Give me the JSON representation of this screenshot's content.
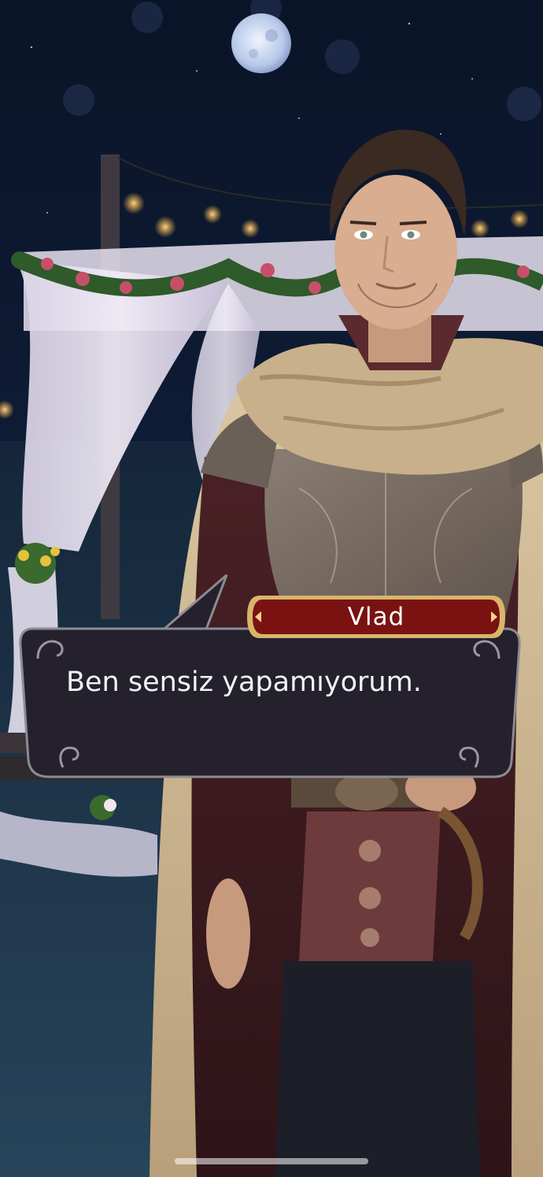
{
  "dialogue": {
    "speaker": "Vlad",
    "text": "Ben sensiz yapamıyorum."
  },
  "colors": {
    "night_sky": "#0b1326",
    "bubble_fill": "#24212c",
    "bubble_border": "#8d8a92",
    "name_plate": "#7a1212",
    "name_plate_border": "#d8b56a"
  },
  "icons": {
    "moon": "moon-icon",
    "bubble_corner": "ornament-icon"
  }
}
